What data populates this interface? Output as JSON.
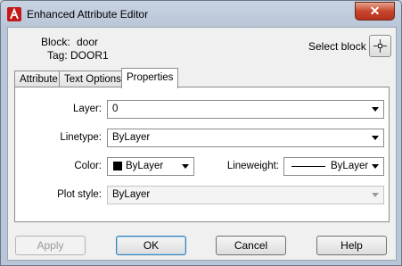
{
  "window": {
    "title": "Enhanced Attribute Editor",
    "close_glyph": "✕"
  },
  "info": {
    "block_label": "Block:",
    "block_value": "door",
    "tag_label": "Tag:",
    "tag_value": "DOOR1",
    "select_block_label": "Select block"
  },
  "tabs": [
    {
      "label": "Attribute",
      "active": false
    },
    {
      "label": "Text Options",
      "active": false
    },
    {
      "label": "Properties",
      "active": true
    }
  ],
  "properties": {
    "layer_label": "Layer:",
    "layer_value": "0",
    "linetype_label": "Linetype:",
    "linetype_value": "ByLayer",
    "color_label": "Color:",
    "color_value": "ByLayer",
    "color_swatch": "#000000",
    "lineweight_label": "Lineweight:",
    "lineweight_value": "ByLayer",
    "plotstyle_label": "Plot style:",
    "plotstyle_value": "ByLayer"
  },
  "buttons": {
    "apply": "Apply",
    "ok": "OK",
    "cancel": "Cancel",
    "help": "Help"
  },
  "icons": {
    "app": "autocad-a-icon",
    "pick": "crosshair-pick-icon"
  }
}
